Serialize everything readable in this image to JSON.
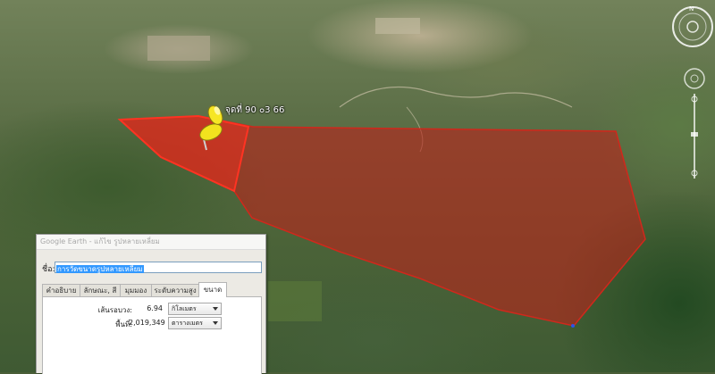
{
  "map": {
    "pin_label": "จุดที่ 90 ๐3 66"
  },
  "dialog": {
    "title": "Google Earth - แก้ไข รูปหลายเหลี่ยม",
    "name_label": "ชื่อ:",
    "name_value": "การวัดขนาดรูปหลายเหลี่ยม",
    "tabs": [
      {
        "label": "คำอธิบาย"
      },
      {
        "label": "ลักษณะ, สี"
      },
      {
        "label": "มุมมอง"
      },
      {
        "label": "ระดับความสูง"
      },
      {
        "label": "ขนาด"
      }
    ],
    "active_tab": "ขนาด",
    "measurements": {
      "perimeter": {
        "label": "เส้นรอบวง:",
        "value": "6.94",
        "unit": "กิโลเมตร"
      },
      "area": {
        "label": "พื้นที่:",
        "value": "2,019,349",
        "unit": "ตารางเมตร"
      }
    }
  },
  "colors": {
    "polygon_fill": "#c0201a",
    "polygon_edge": "#ff2a1a",
    "pushpin": "#f2e21e",
    "selection": "#3399ff"
  },
  "icons": [
    "pushpin-icon",
    "compass-icon",
    "look-joystick-icon",
    "move-joystick-icon",
    "zoom-slider-icon",
    "dropdown-arrow-icon"
  ]
}
